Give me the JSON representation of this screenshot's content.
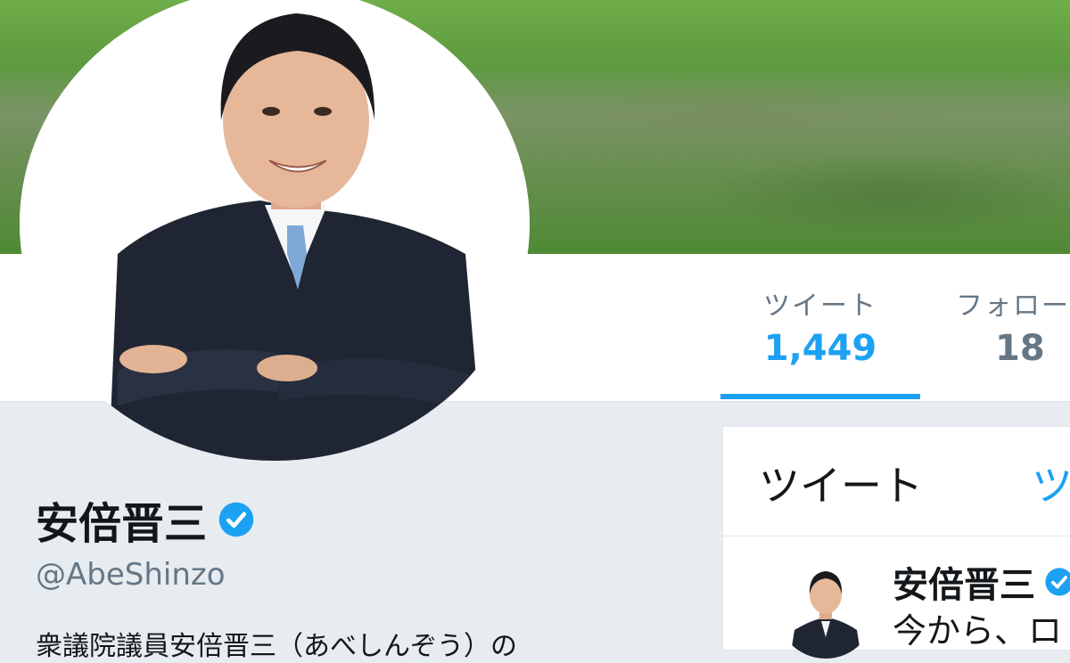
{
  "profile": {
    "display_name": "安倍晋三",
    "handle": "@AbeShinzo",
    "bio": "衆議院議員安倍晋三（あべしんぞう）の"
  },
  "stats": [
    {
      "label": "ツイート",
      "value": "1,449"
    },
    {
      "label": "フォロー",
      "value": "18"
    }
  ],
  "timeline": {
    "tabs": [
      "ツイート",
      "ツ"
    ],
    "tweet": {
      "author": "安倍晋三",
      "text": "今から、ロ"
    }
  },
  "colors": {
    "accent": "#1da1f2",
    "background": "#e6ecf0",
    "secondary_text": "#657786"
  },
  "icons": {
    "verified": "verified-badge-icon"
  }
}
